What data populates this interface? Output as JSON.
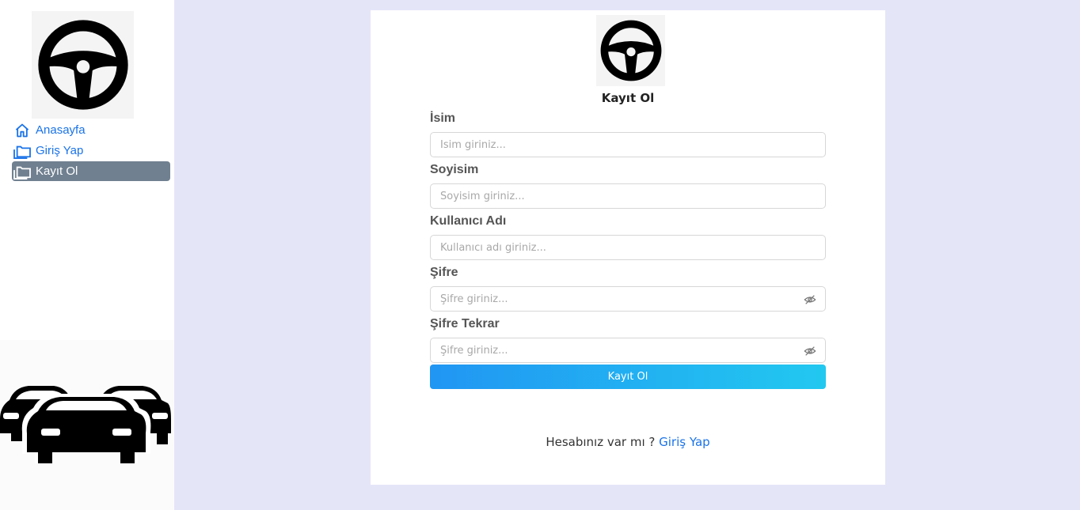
{
  "sidebar": {
    "logo": "steering-wheel-icon",
    "items": [
      {
        "label": "Anasayfa",
        "icon": "home-icon",
        "active": false
      },
      {
        "label": "Giriş Yap",
        "icon": "folders-icon",
        "active": false
      },
      {
        "label": "Kayıt Ol",
        "icon": "folders-icon",
        "active": true
      }
    ],
    "illustration": "cars-icon"
  },
  "card": {
    "logo": "steering-wheel-icon",
    "title": "Kayıt Ol",
    "fields": [
      {
        "label": "İsim",
        "placeholder": "İsim giriniz...",
        "value": ""
      },
      {
        "label": "Soyisim",
        "placeholder": "Soyisim giriniz...",
        "value": ""
      },
      {
        "label": "Kullanıcı Adı",
        "placeholder": "Kullanıcı adı giriniz...",
        "value": ""
      },
      {
        "label": "Şifre",
        "placeholder": "Şifre giriniz...",
        "value": "",
        "icon": "eye-slash-icon"
      },
      {
        "label": "Şifre Tekrar",
        "placeholder": "Şifre giriniz...",
        "value": "",
        "icon": "eye-slash-icon"
      }
    ],
    "submit_label": "Kayıt Ol",
    "footer_text": "Hesabınız var mı ?",
    "footer_link": "Giriş Yap"
  },
  "colors": {
    "background": "#e5e5f8",
    "link": "#1a73e8",
    "active_nav": "#708090",
    "button_start": "#2196f3",
    "button_end": "#22c8f0"
  }
}
